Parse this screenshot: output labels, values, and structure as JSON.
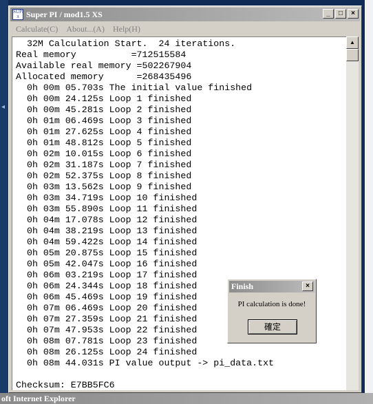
{
  "window": {
    "title": "Super PI / mod1.5 XS",
    "icon_text": "SUPER π",
    "menu": [
      "Calculate(C)",
      "About...(A)",
      "Help(H)"
    ]
  },
  "log_lines": [
    "  32M Calculation Start.  24 iterations.",
    "Real memory          =712515584",
    "Available real memory =502267904",
    "Allocated memory      =268435496",
    "  0h 00m 05.703s The initial value finished",
    "  0h 00m 24.125s Loop 1 finished",
    "  0h 00m 45.281s Loop 2 finished",
    "  0h 01m 06.469s Loop 3 finished",
    "  0h 01m 27.625s Loop 4 finished",
    "  0h 01m 48.812s Loop 5 finished",
    "  0h 02m 10.015s Loop 6 finished",
    "  0h 02m 31.187s Loop 7 finished",
    "  0h 02m 52.375s Loop 8 finished",
    "  0h 03m 13.562s Loop 9 finished",
    "  0h 03m 34.719s Loop 10 finished",
    "  0h 03m 55.890s Loop 11 finished",
    "  0h 04m 17.078s Loop 12 finished",
    "  0h 04m 38.219s Loop 13 finished",
    "  0h 04m 59.422s Loop 14 finished",
    "  0h 05m 20.875s Loop 15 finished",
    "  0h 05m 42.047s Loop 16 finished",
    "  0h 06m 03.219s Loop 17 finished",
    "  0h 06m 24.344s Loop 18 finished",
    "  0h 06m 45.469s Loop 19 finished",
    "  0h 07m 06.469s Loop 20 finished",
    "  0h 07m 27.359s Loop 21 finished",
    "  0h 07m 47.953s Loop 22 finished",
    "  0h 08m 07.781s Loop 23 finished",
    "  0h 08m 26.125s Loop 24 finished",
    "  0h 08m 44.031s PI value output -> pi_data.txt",
    "",
    "Checksum: E7BB5FC6"
  ],
  "dialog": {
    "title": "Finish",
    "message": "PI calculation is done!",
    "ok_label": "確定"
  },
  "taskbar": {
    "text": "oft Internet Explorer"
  },
  "icons": {
    "minimize": "_",
    "maximize": "□",
    "close": "×",
    "scroll_up": "▲"
  }
}
